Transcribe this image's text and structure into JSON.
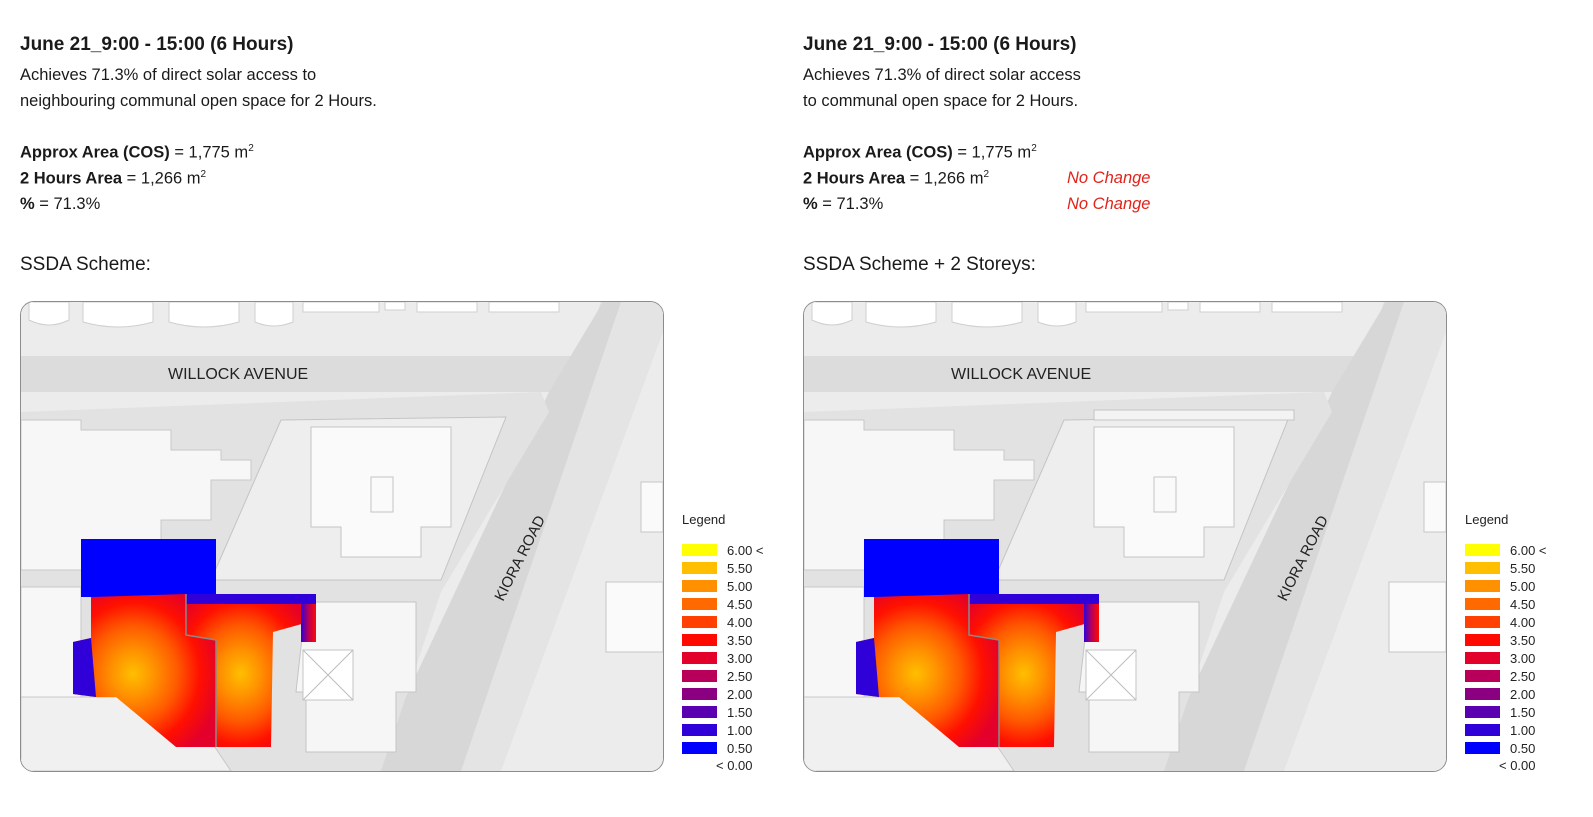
{
  "panels": [
    {
      "title": "June 21_9:00 - 15:00 (6 Hours)",
      "description": "Achieves 71.3% of direct solar access to\nneighbouring communal open space for 2 Hours.",
      "area_cos_label": "Approx Area (COS)",
      "area_cos_value": " = 1,775 m",
      "two_hours_label": "2 Hours Area",
      "two_hours_value": " = 1,266 m",
      "percent_label": "%",
      "percent_value": " = 71.3%",
      "two_hours_note": "",
      "percent_note": "",
      "scheme_label": "SSDA Scheme:",
      "street_label": "WILLOCK AVENUE",
      "road_label": "KIORA ROAD"
    },
    {
      "title": "June 21_9:00 - 15:00 (6 Hours)",
      "description": "Achieves 71.3% of direct solar access\nto communal open space for 2 Hours.",
      "area_cos_label": "Approx Area (COS)",
      "area_cos_value": " = 1,775 m",
      "two_hours_label": "2 Hours Area",
      "two_hours_value": " = 1,266 m",
      "percent_label": "%",
      "percent_value": " = 71.3%",
      "two_hours_note": "No Change",
      "percent_note": "No Change",
      "scheme_label": "SSDA Scheme + 2 Storeys:",
      "street_label": "WILLOCK AVENUE",
      "road_label": "KIORA ROAD"
    }
  ],
  "unit_superscript": "2",
  "legend": {
    "title": "Legend",
    "items": [
      {
        "label": "6.00 <",
        "color": "#ffff00"
      },
      {
        "label": "5.50",
        "color": "#ffbf00"
      },
      {
        "label": "5.00",
        "color": "#ff9000"
      },
      {
        "label": "4.50",
        "color": "#ff6a00"
      },
      {
        "label": "4.00",
        "color": "#ff4000"
      },
      {
        "label": "3.50",
        "color": "#ff0a00"
      },
      {
        "label": "3.00",
        "color": "#e3002a"
      },
      {
        "label": "2.50",
        "color": "#b8005a"
      },
      {
        "label": "2.00",
        "color": "#8a0080"
      },
      {
        "label": "1.50",
        "color": "#5a00b0"
      },
      {
        "label": "1.00",
        "color": "#3000d8"
      },
      {
        "label": "0.50",
        "color": "#0000ff"
      }
    ],
    "last_label": "< 0.00"
  }
}
